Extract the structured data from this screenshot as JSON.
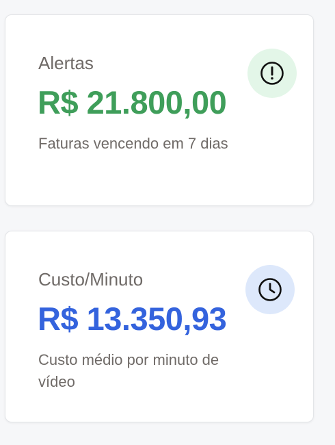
{
  "cards": [
    {
      "title": "Alertas",
      "value": "R$ 21.800,00",
      "description": "Faturas vencendo em 7 dias",
      "value_color": "#3f9e5a",
      "icon": "alert-circle-icon",
      "icon_bg": "#e3f6e8"
    },
    {
      "title": "Custo/Minuto",
      "value": "R$ 13.350,93",
      "description": "Custo médio por minuto de vídeo",
      "value_color": "#3463dd",
      "icon": "clock-icon",
      "icon_bg": "#dde8fb"
    }
  ]
}
